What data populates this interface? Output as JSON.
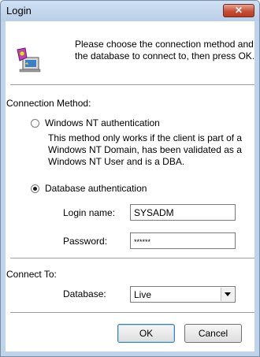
{
  "window": {
    "title": "Login",
    "close_symbol": "✕"
  },
  "header": {
    "icon": "computer-key-icon",
    "text": "Please choose the connection method and the database to connect to, then press OK."
  },
  "connection": {
    "label": "Connection Method:",
    "windows_nt": {
      "label": "Windows NT authentication",
      "selected": false,
      "note": "This method only works if the client is part of a Windows NT Domain, has been validated as a Windows NT User and is a DBA."
    },
    "database_auth": {
      "label": "Database authentication",
      "selected": true
    },
    "login_name": {
      "label": "Login name:",
      "value": "SYSADM"
    },
    "password": {
      "label": "Password:",
      "value": "******"
    }
  },
  "connect_to": {
    "label": "Connect To:",
    "database_label": "Database:",
    "database_value": "Live"
  },
  "buttons": {
    "ok": "OK",
    "cancel": "Cancel"
  }
}
